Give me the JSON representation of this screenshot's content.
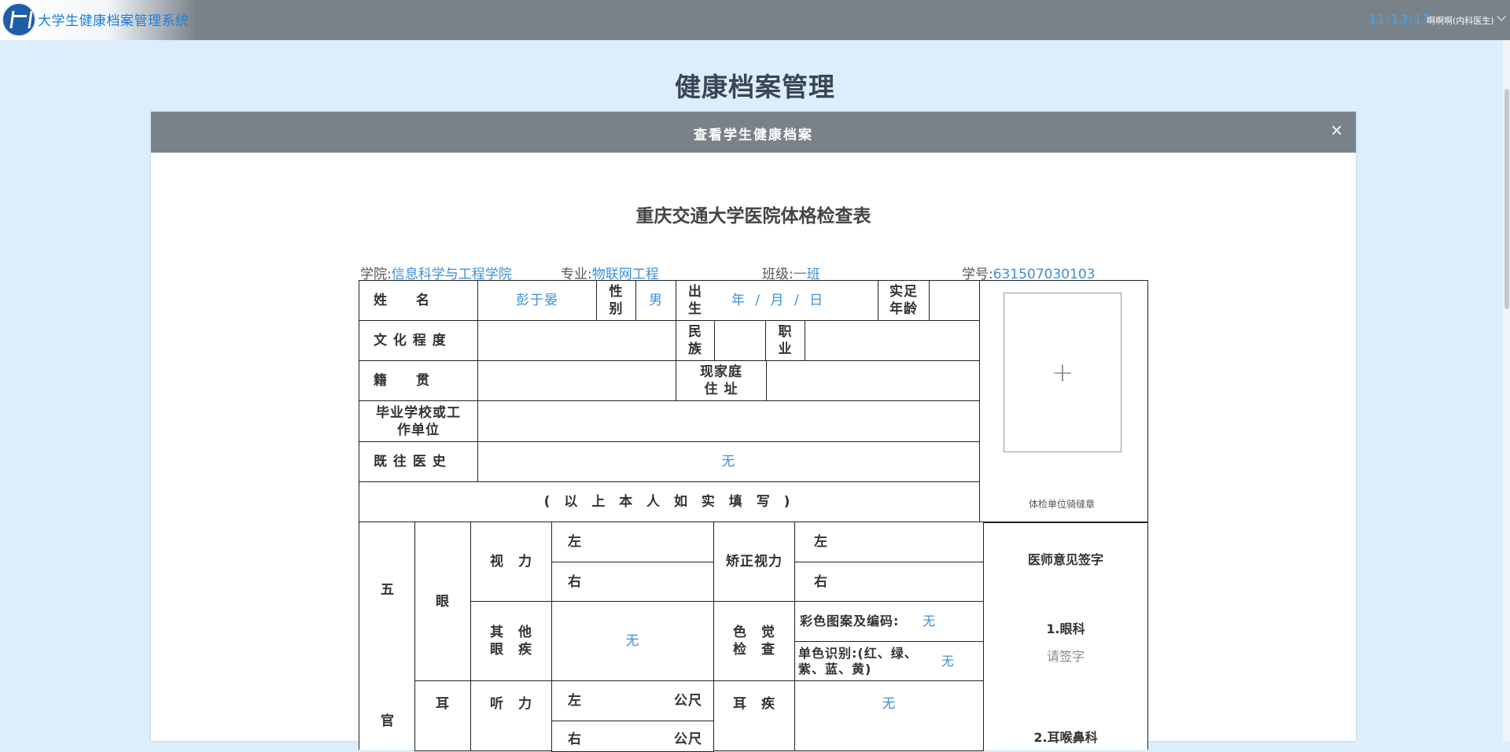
{
  "app": {
    "title": "大学生健康档案管理系统",
    "clock": "11:13:17",
    "user": "啊啊啊(内科医生)"
  },
  "page_title": "健康档案管理",
  "modal": {
    "title": "查看学生健康档案",
    "close": "×",
    "form_title": "重庆交通大学医院体格检查表"
  },
  "student": {
    "college_label": "学院:",
    "college": "信息科学与工程学院",
    "major_label": "专业:",
    "major": "物联网工程",
    "class_label": "班级:",
    "class": "一班",
    "id_label": "学号:",
    "id": "631507030103"
  },
  "form": {
    "name_label": "姓　　名",
    "name": "彭于晏",
    "sex_label": "性别",
    "sex": "男",
    "birth_label": "出生",
    "birth": "年 / 月 / 日",
    "age_label": "实足年龄",
    "education_label": "文 化 程 度",
    "ethnic_label": "民族",
    "job_label": "职业",
    "native_label": "籍　　贯",
    "address_label": "现家庭住 址",
    "school_label": "毕业学校或工作单位",
    "history_label": "既 往 医 史",
    "history": "无",
    "self_fill": "( 以 上 本 人 如 实 填 写 )",
    "photo_plus": "+",
    "stamp": "体检单位骑缝章",
    "five": "五",
    "organs": "官",
    "eye": "眼",
    "ear": "耳",
    "vision_label": "视　力",
    "left": "左",
    "right": "右",
    "corrected_label": "矫正视力",
    "other_eye_label": "其　他眼　疾",
    "other_eye": "无",
    "color_label": "色　觉检　查",
    "color_pattern_label": "彩色图案及编码:",
    "color_pattern": "无",
    "mono_label": "单色识别:(红、绿、紫、蓝、黄)",
    "mono": "无",
    "hearing_label": "听　力",
    "meter": "公尺",
    "ear_disease_label": "耳　疾",
    "ear_disease": "无",
    "doctor_sign_label": "医师意见签字",
    "dept1": "1.眼科",
    "sign_hint": "请签字",
    "dept2": "2.耳喉鼻科"
  }
}
